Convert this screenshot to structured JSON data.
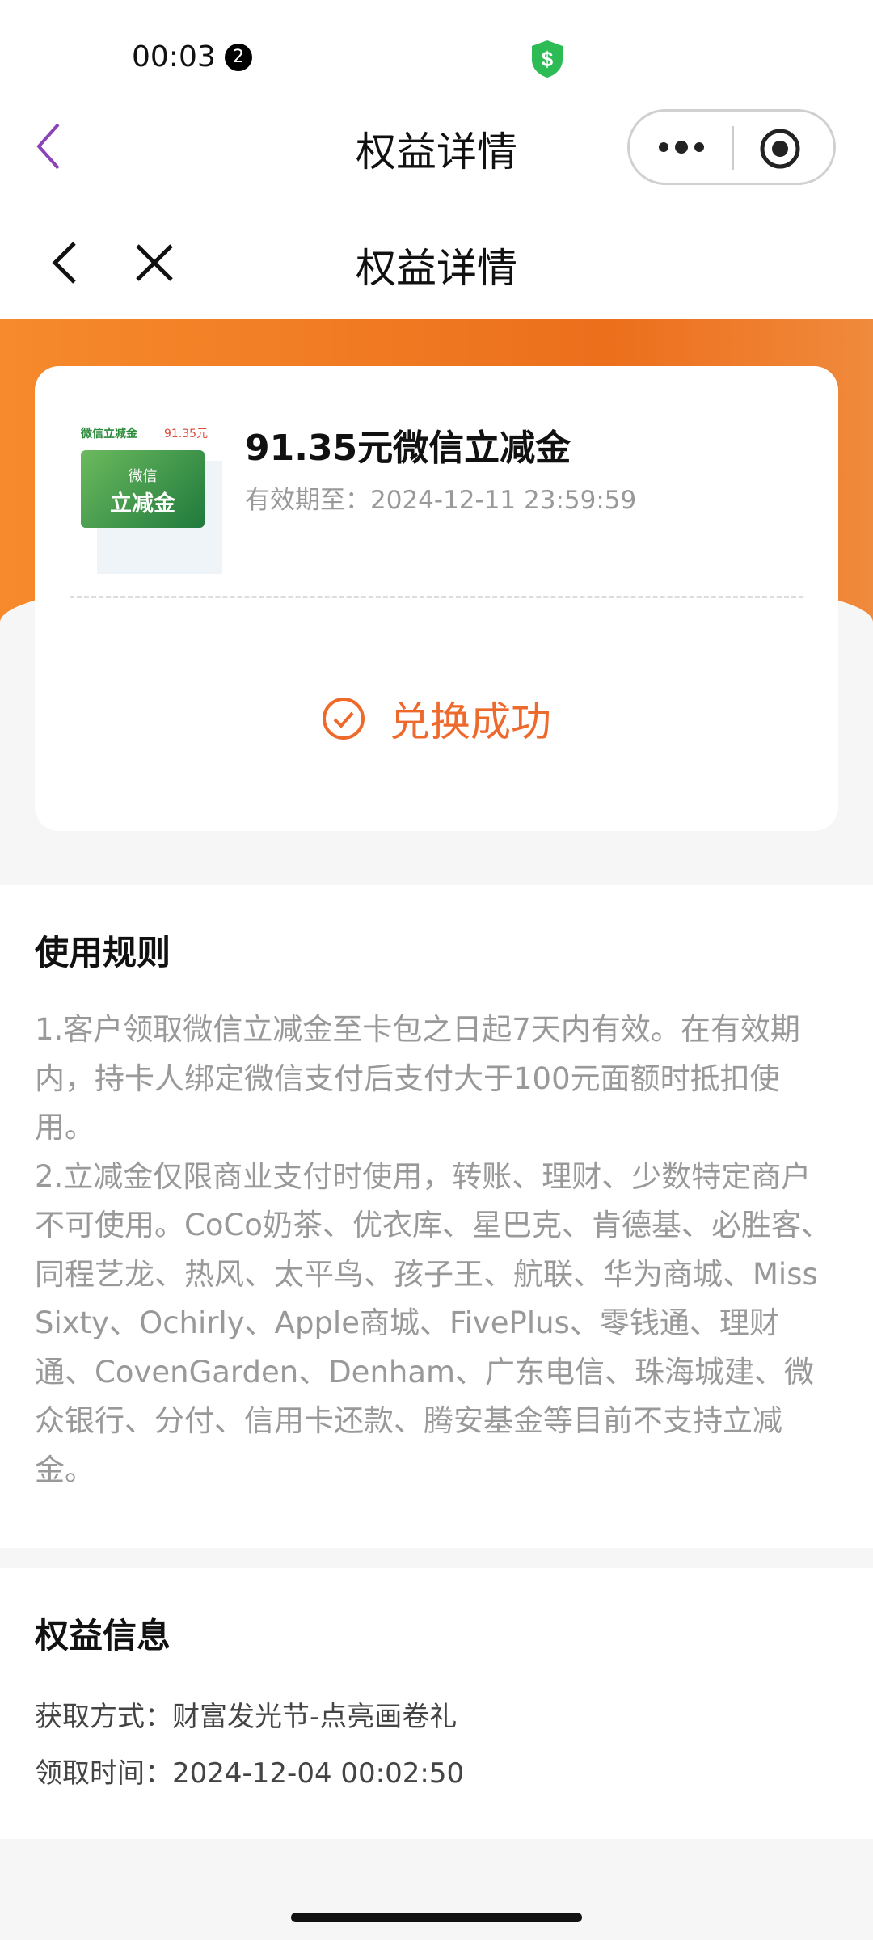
{
  "status_bar": {
    "time": "00:03",
    "notification_count": "2",
    "shield_icon": "shield-dollar-icon",
    "shield_color": "#2dbb55"
  },
  "mini_nav": {
    "title": "权益详情",
    "back_color": "#8a44b8"
  },
  "page_nav": {
    "title": "权益详情"
  },
  "card": {
    "thumb_label": "微信立减金",
    "thumb_amount": "91.35元",
    "thumb_line1": "微信",
    "thumb_line2": "立减金",
    "title": "91.35元微信立减金",
    "expiry": "有效期至：2024-12-11 23:59:59",
    "status": "兑换成功",
    "accent": "#ee6a2c"
  },
  "rules": {
    "title": "使用规则",
    "items": [
      "1.客户领取微信立减金至卡包之日起7天内有效。在有效期内，持卡人绑定微信支付后支付大于100元面额时抵扣使用。",
      "2.立减金仅限商业支付时使用，转账、理财、少数特定商户不可使用。CoCo奶茶、优衣库、星巴克、肯德基、必胜客、同程艺龙、热风、太平鸟、孩子王、航联、华为商城、Miss Sixty、Ochirly、Apple商城、FivePlus、零钱通、理财通、CovenGarden、Denham、广东电信、珠海城建、微众银行、分付、信用卡还款、腾安基金等目前不支持立减金。"
    ]
  },
  "info": {
    "title": "权益信息",
    "source": "获取方式：财富发光节-点亮画卷礼",
    "time": "领取时间：2024-12-04 00:02:50"
  }
}
